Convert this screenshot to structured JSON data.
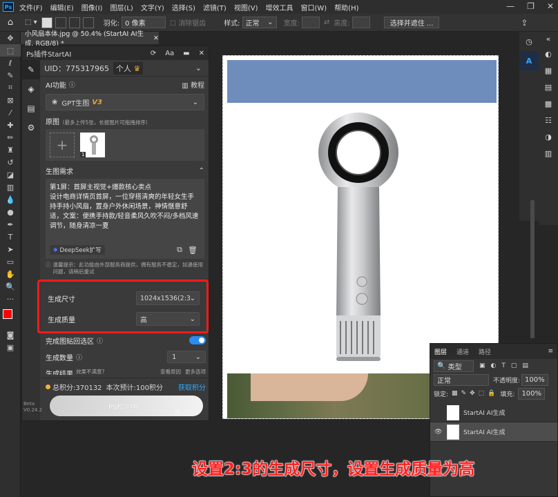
{
  "menu": [
    "文件(F)",
    "编辑(E)",
    "图像(I)",
    "图层(L)",
    "文字(Y)",
    "选择(S)",
    "滤镜(T)",
    "视图(V)",
    "增效工具",
    "窗口(W)",
    "帮助(H)"
  ],
  "options_bar": {
    "feather_label": "羽化:",
    "feather_value": "0 像素",
    "antialias_label": "消除锯齿",
    "style_label": "样式:",
    "style_value": "正常",
    "width_label": "宽度:",
    "height_label": "高度:",
    "select_mask_button": "选择并遮住 ..."
  },
  "document_tab": "小风扇本体.jpg @ 50.4% (StartAI AI生成, RGB/8) *",
  "plugin": {
    "title": "Ps插件StartAI",
    "uid": "UID：775317965",
    "account_type": "个人",
    "ai_function_label": "AI功能",
    "tutorial_label": "教程",
    "model_name": "GPT生图",
    "model_version": "V3",
    "original_label": "原图",
    "original_hint": "（最多上传5张，长按图片可拖拽排序）",
    "thumb_index": "1",
    "requirements_label": "生图需求",
    "prompt_text": "第1屏：首屏主视觉+爆款核心卖点\n设计电商详情页首屏，一位穿搭清爽的年轻女生手持手持小风扇，置身户外休闲场景，神情惬意舒适，文案：便携手持款/轻音柔风久吹不闷/多档风速调节，随身清凉一夏",
    "deepseek_button": "DeepSeek扩写",
    "warning_text": "温馨提示：此功能由外部服务商提供，偶有服务不稳定，如遇使用问题，请稍后重试",
    "size_label": "生成尺寸",
    "size_value": "1024x1536(2:3)",
    "quality_label": "生成质量",
    "quality_value": "高",
    "paste_back_label": "完成图贴回选区",
    "paste_back_on": true,
    "count_label": "生成数量",
    "count_value": "1",
    "result_label": "生成结果",
    "result_hint1": "效果不满意?",
    "result_hint2": "查看原因",
    "result_hint3": "更多选项",
    "total_points": "总积分:370132",
    "estimate": "本次预计:100积分",
    "get_points": "获取积分",
    "detect_button": "PS检测中...",
    "beta_label": "Beta",
    "version": "V0.24.2"
  },
  "layers_panel": {
    "tabs": [
      "图层",
      "通道",
      "路径"
    ],
    "kind_label": "类型",
    "blend_mode": "正常",
    "opacity_label": "不透明度:",
    "opacity_value": "100%",
    "lock_label": "锁定:",
    "fill_label": "填充:",
    "fill_value": "100%",
    "layers": [
      {
        "name": "StartAI AI生成",
        "visible": false
      },
      {
        "name": "StartAI AI生成",
        "visible": true
      }
    ]
  },
  "caption": "设置2:3的生成尺寸，设置生成质量为高",
  "colors": {
    "highlight_red": "#ff1a1a",
    "accent_blue": "#31a8ff",
    "toggle_blue": "#2a8cf0",
    "gold": "#e8a33b",
    "sky_blue": "#6e8dbd"
  }
}
